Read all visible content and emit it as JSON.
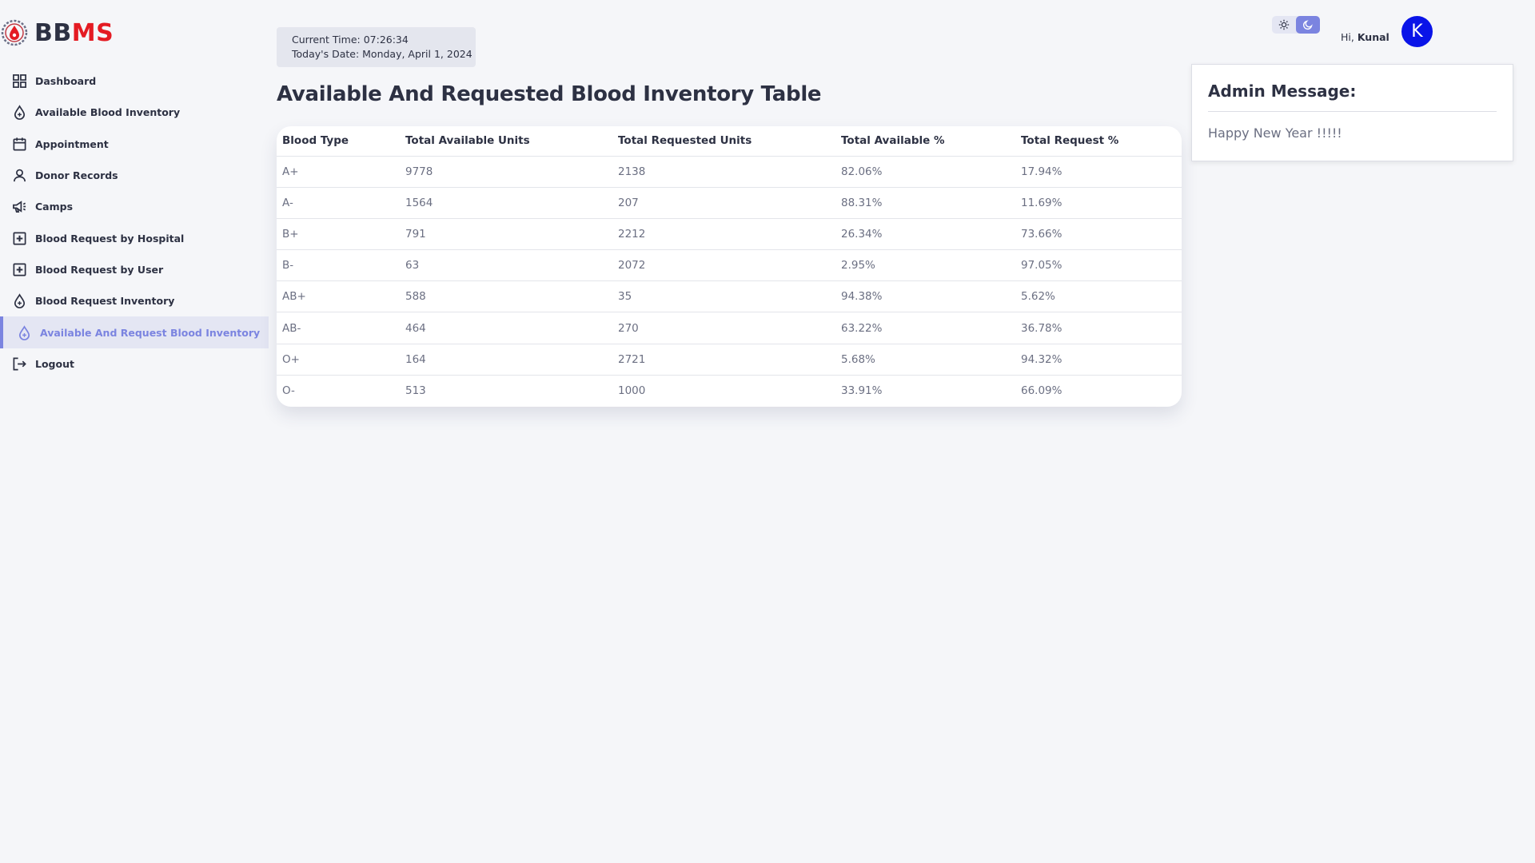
{
  "brand": {
    "part1": "BB",
    "part2": "MS",
    "accent": "#e41b23"
  },
  "sidebar": {
    "items": [
      {
        "label": "Dashboard",
        "icon": "grid-icon",
        "active": false
      },
      {
        "label": "Available Blood Inventory",
        "icon": "blood-drop-icon",
        "active": false
      },
      {
        "label": "Appointment",
        "icon": "calendar-icon",
        "active": false
      },
      {
        "label": "Donor Records",
        "icon": "user-icon",
        "active": false
      },
      {
        "label": "Camps",
        "icon": "megaphone-icon",
        "active": false
      },
      {
        "label": "Blood Request by Hospital",
        "icon": "plus-square-icon",
        "active": false
      },
      {
        "label": "Blood Request by User",
        "icon": "plus-square-icon",
        "active": false
      },
      {
        "label": "Blood Request Inventory",
        "icon": "blood-drop-icon",
        "active": false
      },
      {
        "label": "Available And Request Blood Inventory",
        "icon": "blood-drop-icon",
        "active": true
      },
      {
        "label": "Logout",
        "icon": "logout-icon",
        "active": false
      }
    ]
  },
  "clock": {
    "time_line": "Current Time: 07:26:34",
    "date_line": "Today's Date: Monday, April 1, 2024"
  },
  "page": {
    "title": "Available And Requested Blood Inventory Table"
  },
  "table": {
    "headers": [
      "Blood Type",
      "Total Available Units",
      "Total Requested Units",
      "Total Available %",
      "Total Request %"
    ],
    "rows": [
      [
        "A+",
        "9778",
        "2138",
        "82.06%",
        "17.94%"
      ],
      [
        "A-",
        "1564",
        "207",
        "88.31%",
        "11.69%"
      ],
      [
        "B+",
        "791",
        "2212",
        "26.34%",
        "73.66%"
      ],
      [
        "B-",
        "63",
        "2072",
        "2.95%",
        "97.05%"
      ],
      [
        "AB+",
        "588",
        "35",
        "94.38%",
        "5.62%"
      ],
      [
        "AB-",
        "464",
        "270",
        "63.22%",
        "36.78%"
      ],
      [
        "O+",
        "164",
        "2721",
        "5.68%",
        "94.32%"
      ],
      [
        "O-",
        "513",
        "1000",
        "33.91%",
        "66.09%"
      ]
    ]
  },
  "header": {
    "greeting_prefix": "Hi, ",
    "user_name": "Kunal",
    "avatar_letter": "K",
    "avatar_color": "#0a14e8",
    "theme": "dark"
  },
  "admin": {
    "title": "Admin Message:",
    "message": "Happy New Year !!!!!"
  }
}
